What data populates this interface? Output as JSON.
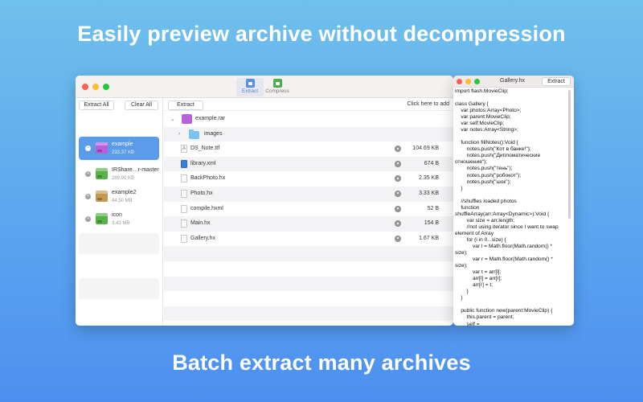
{
  "headlines": {
    "top": "Easily preview archive without decompression",
    "bottom": "Batch extract many archives"
  },
  "toolbar": {
    "extract_label": "Extract",
    "compress_label": "Compress"
  },
  "sidebar": {
    "extract_all": "Extract All",
    "clear_all": "Clear All",
    "archives": [
      {
        "name": "example",
        "size": "233.37 KB",
        "selected": true,
        "color": "#b85fd9"
      },
      {
        "name": "IRShare…r-master",
        "size": "289.90 KB",
        "selected": false,
        "color": "#55b24a"
      },
      {
        "name": "example2",
        "size": "44.50 MB",
        "selected": false,
        "color": "#c49a52"
      },
      {
        "name": "icon",
        "size": "3.43 MB",
        "selected": false,
        "color": "#55b24a"
      }
    ]
  },
  "main": {
    "extract_button": "Extract",
    "click_here": "Click here to add",
    "root": "example.rar",
    "folder": "images",
    "files": [
      {
        "name": "DS_Note.ttf",
        "size": "104.69 KB",
        "icon": "font-file-icon"
      },
      {
        "name": "library.xml",
        "size": "674 B",
        "icon": "xml-file-icon"
      },
      {
        "name": "BackPhoto.hx",
        "size": "2.35 KB",
        "icon": "file-icon"
      },
      {
        "name": "Photo.hx",
        "size": "3.33 KB",
        "icon": "file-icon"
      },
      {
        "name": "compile.hxml",
        "size": "52 B",
        "icon": "file-icon"
      },
      {
        "name": "Main.hx",
        "size": "154 B",
        "icon": "file-icon"
      },
      {
        "name": "Gallery.hx",
        "size": "1.67 KB",
        "icon": "file-icon"
      }
    ]
  },
  "preview": {
    "title": "Gallery.hx",
    "extract_button": "Extract",
    "code": [
      "import flash.MovieClip;",
      "",
      "class Gallery {",
      "    var photos:Array<Photo>;",
      "    var parent:MovieClip;",
      "    var self:MovieClip;",
      "    var notes:Array<String>;",
      "",
      "    function fillNotes():Void {",
      "        notes.push(\"Кот в банке!\");",
      "        notes.push(\"Дипломатические отношения\");",
      "        notes.push(\"тень\");",
      "        notes.push(\"робокот\");",
      "        notes.push(\"шок\");",
      "    }",
      "",
      "    //shuffles loaded photos",
      "    function shuffleArray(arr:Array<Dynamic>):Void {",
      "        var size = arr.length;",
      "        //not using iterator since I want to swap element of Array",
      "        for (i in 0...size) {",
      "            var l = Math.floor(Math.random() * size);",
      "            var r = Math.floor(Math.random() * size);",
      "            var t = arr[l];",
      "            arr[l] = arr[r];",
      "            arr[r] = t;",
      "        }",
      "    }",
      "",
      "    public function new(parent:MovieClip) {",
      "        this.parent = parent;",
      "        self = parent.createEmptyMovieClip(\"gallery\",parent"
    ]
  }
}
